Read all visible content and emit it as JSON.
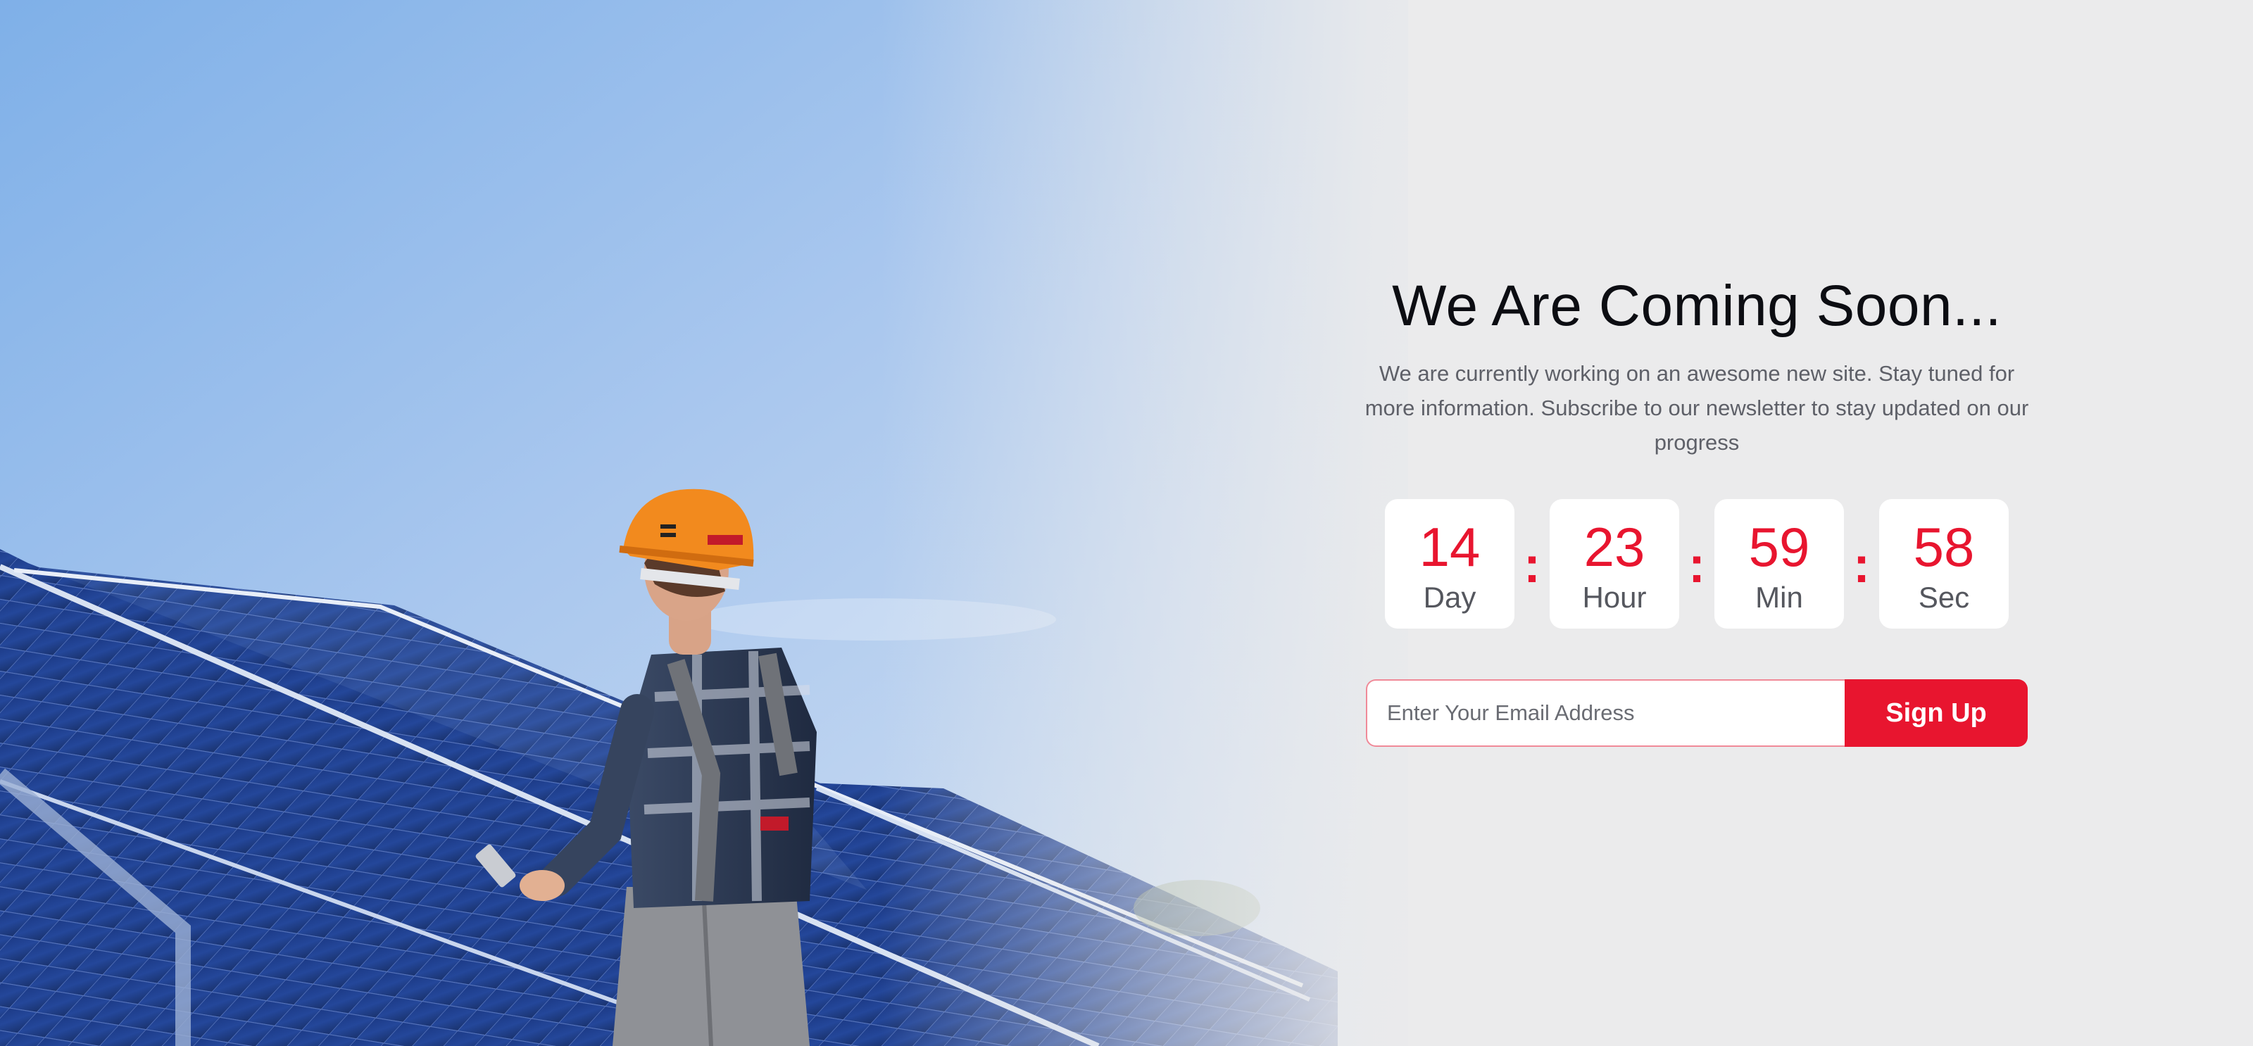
{
  "hero": {
    "image_description_icon": "solar-worker-photo"
  },
  "main": {
    "title": "We Are Coming Soon...",
    "subtitle": "We are currently working on an awesome new site. Stay tuned for more information. Subscribe to our newsletter to stay updated on our progress"
  },
  "countdown": {
    "separator": ":",
    "items": [
      {
        "value": "14",
        "unit": "Day"
      },
      {
        "value": "23",
        "unit": "Hour"
      },
      {
        "value": "59",
        "unit": "Min"
      },
      {
        "value": "58",
        "unit": "Sec"
      }
    ]
  },
  "newsletter": {
    "email_placeholder": "Enter Your Email Address",
    "email_value": "",
    "button_label": "Sign Up"
  },
  "colors": {
    "accent": "#e8152f",
    "heading": "#0c0d12",
    "body_text": "#5e6068",
    "background": "#ebebec",
    "box_bg": "#ffffff"
  }
}
